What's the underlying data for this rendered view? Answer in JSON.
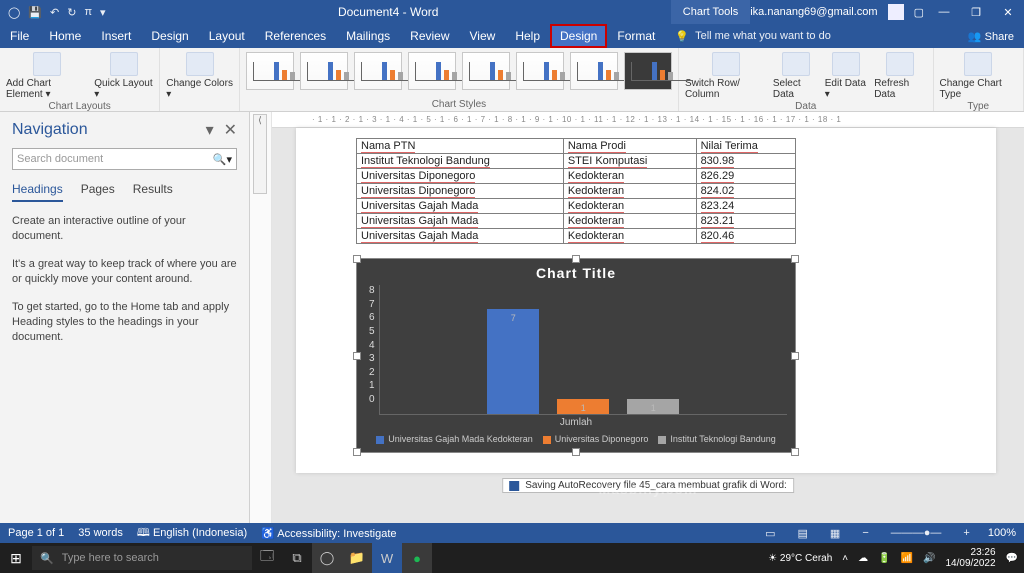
{
  "colors": {
    "accent": "#2b579a",
    "series1": "#4472c4",
    "series2": "#ed7d31",
    "series3": "#a5a5a5"
  },
  "titlebar": {
    "doc_title": "Document4 - Word",
    "context_tab": "Chart Tools",
    "user_email": "ika.nanang69@gmail.com"
  },
  "menubar": {
    "tabs": [
      "File",
      "Home",
      "Insert",
      "Design",
      "Layout",
      "References",
      "Mailings",
      "Review",
      "View",
      "Help",
      "Design",
      "Format"
    ],
    "active_index": 10,
    "tellme": "Tell me what you want to do",
    "share": "Share"
  },
  "ribbon": {
    "groups": {
      "layouts": {
        "label": "Chart Layouts",
        "btns": [
          "Add Chart Element ▾",
          "Quick Layout ▾"
        ]
      },
      "colors": {
        "btn": "Change Colors ▾"
      },
      "styles": {
        "label": "Chart Styles"
      },
      "data": {
        "label": "Data",
        "btns": [
          "Switch Row/ Column",
          "Select Data",
          "Edit Data ▾",
          "Refresh Data"
        ]
      },
      "type": {
        "label": "Type",
        "btn": "Change Chart Type"
      }
    }
  },
  "navigation": {
    "title": "Navigation",
    "search_placeholder": "Search document",
    "tabs": [
      "Headings",
      "Pages",
      "Results"
    ],
    "active_tab": 0,
    "hints": [
      "Create an interactive outline of your document.",
      "It's a great way to keep track of where you are or quickly move your content around.",
      "To get started, go to the Home tab and apply Heading styles to the headings in your document."
    ]
  },
  "table": {
    "headers": [
      "Nama PTN",
      "Nama Prodi",
      "Nilai Terima"
    ],
    "rows": [
      [
        "Institut Teknologi Bandung",
        "STEI Komputasi",
        "830.98"
      ],
      [
        "Universitas Diponegoro",
        "Kedokteran",
        "826.29"
      ],
      [
        "Universitas Diponegoro",
        "Kedokteran",
        "824.02"
      ],
      [
        "Universitas Gajah Mada",
        "Kedokteran",
        "823.24"
      ],
      [
        "Universitas Gajah Mada",
        "Kedokteran",
        "823.21"
      ],
      [
        "Universitas Gajah Mada",
        "Kedokteran",
        "820.46"
      ]
    ]
  },
  "chart_data": {
    "type": "bar",
    "title": "Chart Title",
    "xlabel": "Jumlah",
    "ylabel": "",
    "ylim": [
      0,
      8
    ],
    "yticks": [
      0,
      1,
      2,
      3,
      4,
      5,
      6,
      7,
      8
    ],
    "categories": [
      "Universitas Gajah Mada Kedokteran",
      "Universitas Diponegoro",
      "Institut Teknologi Bandung"
    ],
    "values": [
      7,
      1,
      1
    ],
    "series_colors": [
      "#4472c4",
      "#ed7d31",
      "#a5a5a5"
    ],
    "legend_position": "bottom"
  },
  "statusbar": {
    "page": "Page 1 of 1",
    "words": "35 words",
    "lang": "English (Indonesia)",
    "access": "Accessibility: Investigate",
    "zoom": "100%",
    "saving_msg": "Saving AutoRecovery file 45_cara membuat grafik di Word:"
  },
  "taskbar": {
    "search_placeholder": "Type here to search",
    "weather": "29°C  Cerah",
    "time": "23:26",
    "date": "14/09/2022"
  },
  "watermark": "Masbilly.com"
}
